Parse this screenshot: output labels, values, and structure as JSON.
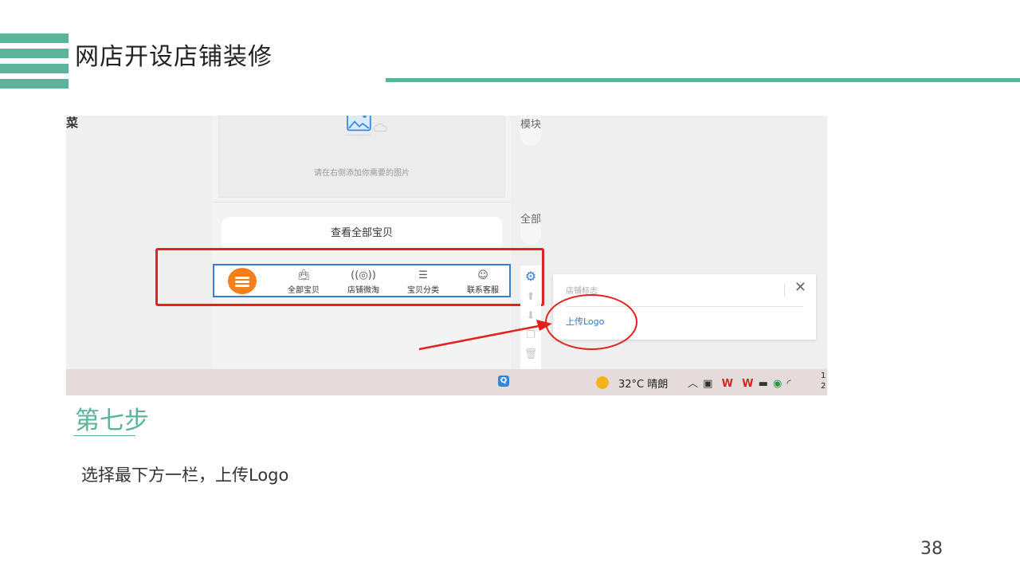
{
  "slide": {
    "title": "网店开设店铺装修",
    "step_title": "第七步",
    "step_desc": "选择最下方一栏，上传Logo",
    "page_number": "38",
    "accent_color": "#5ab39a"
  },
  "screenshot": {
    "left_edge_char": "菜",
    "image_hint": "请在右侧添加你需要的图片",
    "view_all_label": "查看全部宝贝",
    "side_tabs": {
      "module": "模块",
      "all": "全部"
    },
    "bottom_nav": [
      {
        "icon": "bag-icon",
        "label": "全部宝贝"
      },
      {
        "icon": "broadcast-icon",
        "label": "店铺微淘"
      },
      {
        "icon": "list-icon",
        "label": "宝贝分类"
      },
      {
        "icon": "smile-icon",
        "label": "联系客服"
      }
    ],
    "logo_panel": {
      "title": "店铺标志",
      "upload_label": "上传Logo"
    },
    "taskbar": {
      "weather": "32°C 晴朗"
    },
    "highlight_color": "#e3221e",
    "selection_color": "#3a7fd0"
  }
}
